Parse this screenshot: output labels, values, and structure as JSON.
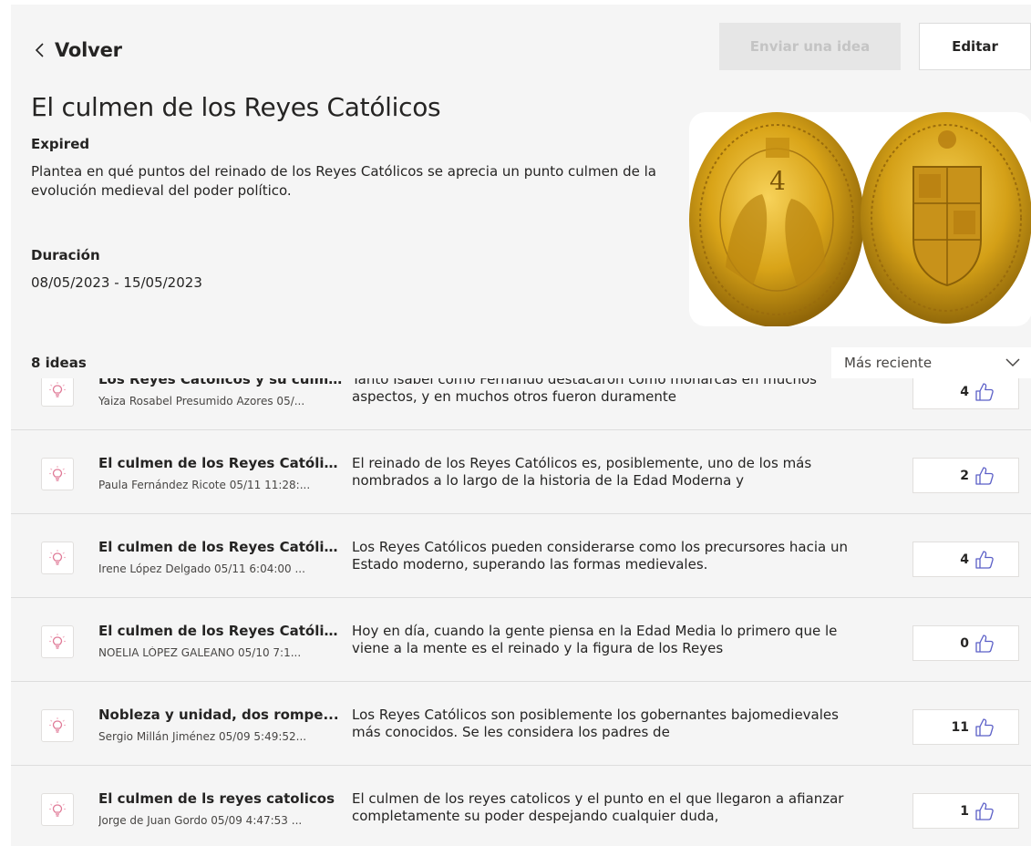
{
  "header": {
    "back_label": "Volver",
    "submit_label": "Enviar una idea",
    "edit_label": "Editar"
  },
  "challenge": {
    "title": "El culmen de los Reyes Católicos",
    "status": "Expired",
    "description": "Plantea en qué puntos del reinado de los Reyes Católicos se aprecia un punto culmen de la evolución medieval del poder político.",
    "duration_label": "Duración",
    "duration": "08/05/2023 - 15/05/2023"
  },
  "list": {
    "count_label": "8 ideas",
    "sort_label": "Más reciente"
  },
  "ideas": [
    {
      "title": "Los Reyes Católicos y su culmin...",
      "meta": "Yaiza Rosabel Presumido Azores  05/...",
      "snippet": "Tanto Isabel como Fernando destacaron como monarcas en muchos aspectos, y en muchos otros fueron duramente",
      "votes": "4"
    },
    {
      "title": "El culmen de los Reyes Católicos",
      "meta": "Paula Fernández Ricote  05/11 11:28:...",
      "snippet": "El reinado de los Reyes Católicos es, posiblemente, uno de los más nombrados a lo largo de la historia de la Edad Moderna y",
      "votes": "2"
    },
    {
      "title": "El culmen de los Reyes Católicos",
      "meta": "Irene López Delgado  05/11 6:04:00 ...",
      "snippet": "Los Reyes Católicos pueden considerarse como los precursores hacia un Estado moderno, superando las formas medievales.",
      "votes": "4"
    },
    {
      "title": "El culmen de los Reyes Católicos",
      "meta": "NOELIA LÓPEZ GALEANO  05/10 7:1...",
      "snippet": "Hoy en día, cuando la gente piensa en la Edad Media lo primero que le viene a la mente es el reinado y la figura de los Reyes",
      "votes": "0"
    },
    {
      "title": "Nobleza y unidad, dos rompe...",
      "meta": "Sergio Millán Jiménez  05/09 5:49:52...",
      "snippet": "Los Reyes Católicos son posiblemente los gobernantes bajomedievales más conocidos. Se les considera los padres de",
      "votes": "11"
    },
    {
      "title": "El culmen de ls reyes catolicos",
      "meta": "Jorge de Juan Gordo  05/09 4:47:53 ...",
      "snippet": "El culmen de los reyes catolicos y el punto en el que llegaron a afianzar completamente su poder despejando cualquier duda,",
      "votes": "1"
    }
  ],
  "colors": {
    "panel_bg": "#f5f5f5",
    "accent_icon": "#e8a4b4",
    "disabled_text": "#c4c4c4",
    "gold": "#d4a017"
  },
  "icons": {
    "back": "chevron-left-icon",
    "sort": "chevron-down-icon",
    "idea": "lightbulb-icon",
    "vote": "thumbs-up-icon"
  }
}
